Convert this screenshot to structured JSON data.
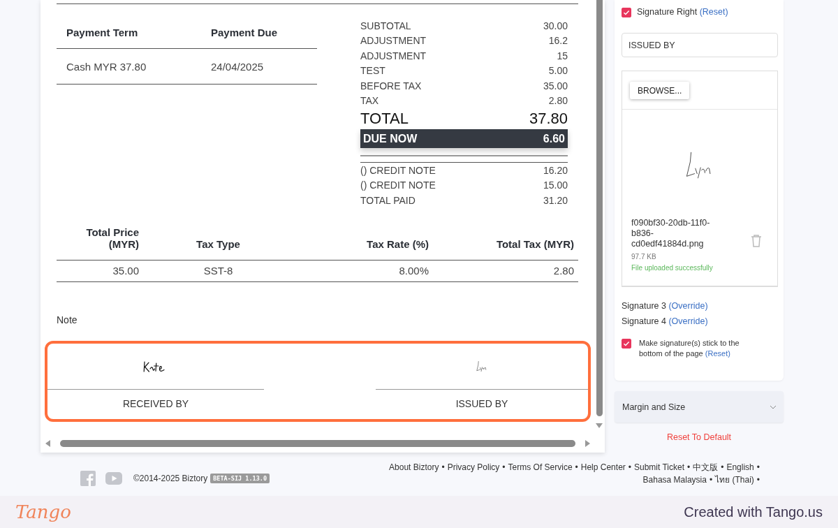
{
  "payment_table": {
    "columns": [
      "Payment Term",
      "Payment Due"
    ],
    "rows": [
      [
        "Cash MYR 37.80",
        "24/04/2025"
      ]
    ]
  },
  "totals": [
    {
      "kind": "line",
      "label": "SUBTOTAL",
      "value": "30.00"
    },
    {
      "kind": "line",
      "label": "ADJUSTMENT",
      "value": "16.2"
    },
    {
      "kind": "line",
      "label": "ADJUSTMENT",
      "value": "15"
    },
    {
      "kind": "line",
      "label": "TEST",
      "value": "5.00"
    },
    {
      "kind": "line",
      "label": "BEFORE TAX",
      "value": "35.00"
    },
    {
      "kind": "line",
      "label": "TAX",
      "value": "2.80"
    },
    {
      "kind": "total",
      "label": "TOTAL",
      "value": "37.80"
    },
    {
      "kind": "due",
      "label": "DUE NOW",
      "value": "6.60"
    }
  ],
  "payments": [
    {
      "label": "() CREDIT NOTE",
      "value": "16.20"
    },
    {
      "label": "() CREDIT NOTE",
      "value": "15.00"
    },
    {
      "label": "TOTAL PAID",
      "value": "31.20"
    }
  ],
  "tax_table": {
    "columns": [
      "Total Price (MYR)",
      "Tax Type",
      "Tax Rate (%)",
      "Total Tax (MYR)"
    ],
    "rows": [
      [
        "35.00",
        "SST-8",
        "8.00%",
        "2.80"
      ]
    ]
  },
  "note": "Note",
  "signatures": {
    "highlighted": true,
    "items": [
      {
        "label": "RECEIVED BY"
      },
      {
        "label": "ISSUED BY"
      }
    ]
  },
  "sidebar": {
    "signature_right": {
      "label": "Signature Right",
      "link": "(Reset)",
      "checked": true
    },
    "label_field": {
      "value": "ISSUED BY"
    },
    "browse_button": "BROWSE...",
    "file": {
      "name": "f090bf30-20db-11f0-b836-cd0edf41884d.png",
      "size": "97.7 KB",
      "status": "File uploaded successfully"
    },
    "overrides": [
      {
        "label": "Signature 3",
        "link": "(Override)"
      },
      {
        "label": "Signature 4",
        "link": "(Override)"
      }
    ],
    "stick": {
      "label": "Make signature(s) stick to the bottom of the page",
      "link": "(Reset)",
      "checked": true
    },
    "accordion": {
      "label": "Margin and Size",
      "expanded": false
    },
    "reset_button": "Reset To Default"
  },
  "footer": {
    "copyright": "©2014-2025 Biztory",
    "version": "BETA-SIJ 1.13.0",
    "lines": [
      [
        {
          "label": "About Biztory",
          "sep": "•"
        },
        {
          "label": "Privacy Policy",
          "sep": "•"
        },
        {
          "label": "Terms Of Service",
          "sep": "•"
        },
        {
          "label": "Help Center",
          "sep": "•"
        },
        {
          "label": "Submit Ticket",
          "sep": "•"
        },
        {
          "label": "中文版",
          "sep": "•"
        },
        {
          "label": "English",
          "sep": "•"
        }
      ],
      [
        {
          "label": "Bahasa Malaysia",
          "sep": "•"
        },
        {
          "label": "ไทย (Thai)",
          "sep": "•"
        }
      ]
    ]
  },
  "tango": {
    "logo": "Tango",
    "credit": "Created with Tango.us"
  }
}
